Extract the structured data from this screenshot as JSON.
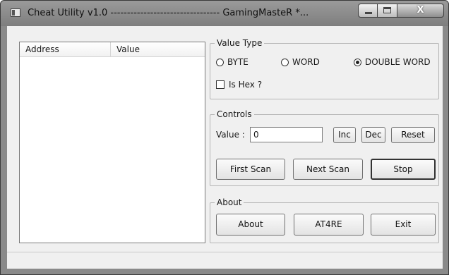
{
  "window": {
    "title": "Cheat Utility v1.0 --------------------------------- GamingMasteR *...",
    "close_glyph": "X"
  },
  "list": {
    "columns": [
      "Address",
      "Value"
    ],
    "rows": []
  },
  "value_type": {
    "label": "Value Type",
    "options": [
      "BYTE",
      "WORD",
      "DOUBLE WORD"
    ],
    "selected": "DOUBLE WORD",
    "is_hex_label": "Is Hex ?",
    "is_hex_checked": false
  },
  "controls": {
    "label": "Controls",
    "value_label": "Value :",
    "value": "0",
    "inc_label": "Inc",
    "dec_label": "Dec",
    "reset_label": "Reset",
    "first_scan_label": "First Scan",
    "next_scan_label": "Next Scan",
    "stop_label": "Stop"
  },
  "about": {
    "label": "About",
    "about_label": "About",
    "at4re_label": "AT4RE",
    "exit_label": "Exit"
  }
}
